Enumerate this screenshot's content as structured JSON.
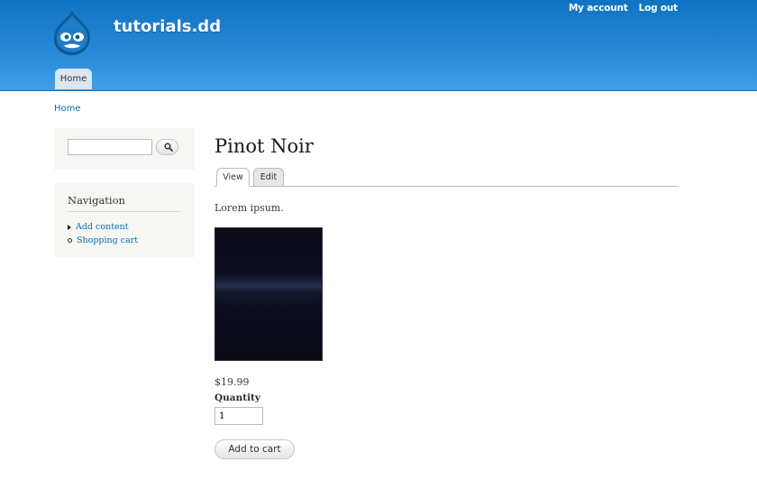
{
  "header": {
    "site_name": "tutorials.dd",
    "secondary_menu": [
      "My account",
      "Log out"
    ],
    "main_menu": [
      "Home"
    ]
  },
  "breadcrumb": [
    "Home"
  ],
  "sidebar": {
    "search": {
      "value": "",
      "icon": "search-icon"
    },
    "navigation": {
      "title": "Navigation",
      "items": [
        "Add content",
        "Shopping cart"
      ]
    }
  },
  "content": {
    "title": "Pinot Noir",
    "tabs": [
      "View",
      "Edit"
    ],
    "active_tab": "View",
    "body": "Lorem ipsum.",
    "price": "$19.99",
    "quantity_label": "Quantity",
    "quantity_value": "1",
    "add_to_cart_label": "Add to cart"
  },
  "colors": {
    "header_blue": "#2a8ad7",
    "link_blue": "#0071b3",
    "sidebar_bg": "#f6f6f2"
  }
}
